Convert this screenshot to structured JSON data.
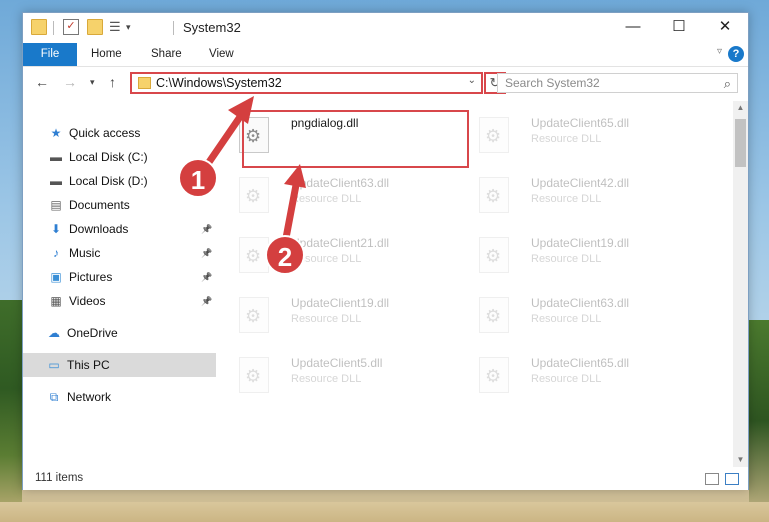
{
  "window": {
    "title": "System32",
    "controls": {
      "minimize": "—",
      "maximize": "☐",
      "close": "✕"
    }
  },
  "ribbon": {
    "tabs": [
      "File",
      "Home",
      "Share",
      "View"
    ],
    "help": "?"
  },
  "address": {
    "path": "C:\\Windows\\System32",
    "search_placeholder": "Search System32"
  },
  "nav": [
    {
      "label": "Quick access",
      "icon": "star-icon",
      "pinned": false
    },
    {
      "label": "Local Disk (C:)",
      "icon": "drive-icon",
      "pinned": false
    },
    {
      "label": "Local Disk (D:)",
      "icon": "drive-icon",
      "pinned": false
    },
    {
      "label": "Documents",
      "icon": "document-icon",
      "pinned": false
    },
    {
      "label": "Downloads",
      "icon": "download-icon",
      "pinned": true
    },
    {
      "label": "Music",
      "icon": "music-icon",
      "pinned": true
    },
    {
      "label": "Pictures",
      "icon": "pictures-icon",
      "pinned": true
    },
    {
      "label": "Videos",
      "icon": "videos-icon",
      "pinned": true
    },
    {
      "label": "OneDrive",
      "icon": "cloud-icon",
      "pinned": false
    },
    {
      "label": "This PC",
      "icon": "computer-icon",
      "pinned": false,
      "selected": true
    },
    {
      "label": "Network",
      "icon": "network-icon",
      "pinned": false
    }
  ],
  "files": [
    {
      "name": "pngdialog.dll",
      "type": ""
    },
    {
      "name": "UpdateClient65.dll",
      "type": "Resource DLL"
    },
    {
      "name": "UpdateClient63.dll",
      "type": "Resource DLL"
    },
    {
      "name": "UpdateClient42.dll",
      "type": "Resource DLL"
    },
    {
      "name": "UpdateClient21.dll",
      "type": "Resource DLL"
    },
    {
      "name": "UpdateClient19.dll",
      "type": "Resource DLL"
    },
    {
      "name": "UpdateClient19.dll",
      "type": "Resource DLL"
    },
    {
      "name": "UpdateClient63.dll",
      "type": "Resource DLL"
    },
    {
      "name": "UpdateClient5.dll",
      "type": "Resource DLL"
    },
    {
      "name": "UpdateClient65.dll",
      "type": "Resource DLL"
    }
  ],
  "status": {
    "item_count": "111 items"
  },
  "annotations": {
    "step1": "1",
    "step2": "2",
    "color": "#d8474b"
  }
}
